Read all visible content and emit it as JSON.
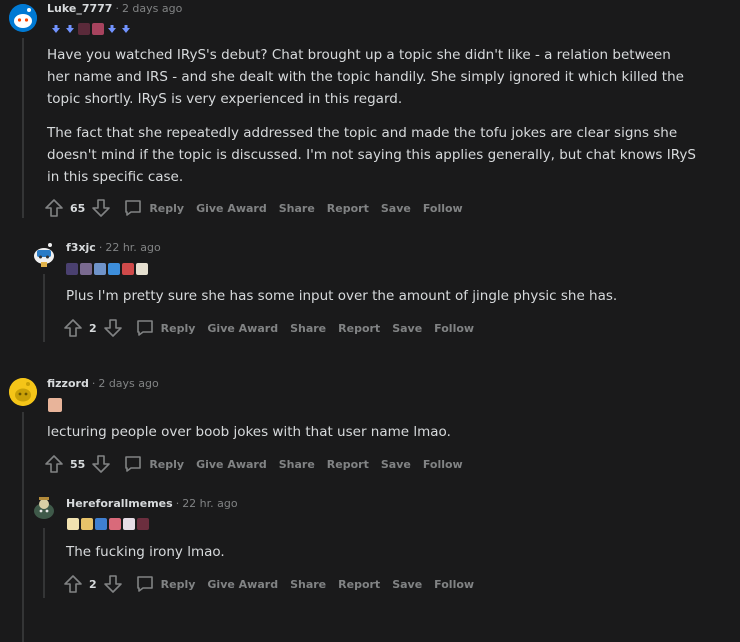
{
  "comments": [
    {
      "username": "Luke_7777",
      "time": "2 days ago",
      "paragraphs": [
        "Have you watched IRyS's debut? Chat brought up a topic she didn't like - a relation between her name and IRS - and she dealt with the topic handily. She simply ignored it which killed the topic shortly. IRyS is very experienced in this regard.",
        "The fact that she repeatedly addressed the topic and made the tofu jokes are clear signs she doesn't mind if the topic is discussed. I'm not saying this applies generally, but chat knows IRyS in this specific case."
      ],
      "score": "65",
      "actions": {
        "reply": "Reply",
        "award": "Give Award",
        "share": "Share",
        "report": "Report",
        "save": "Save",
        "follow": "Follow"
      }
    },
    {
      "username": "f3xjc",
      "time": "22 hr. ago",
      "paragraphs": [
        "Plus I'm pretty sure she has some input over the amount of jingle physic she has."
      ],
      "score": "2",
      "actions": {
        "reply": "Reply",
        "award": "Give Award",
        "share": "Share",
        "report": "Report",
        "save": "Save",
        "follow": "Follow"
      }
    },
    {
      "username": "fizzord",
      "time": "2 days ago",
      "paragraphs": [
        "lecturing people over boob jokes with that user name lmao."
      ],
      "score": "55",
      "actions": {
        "reply": "Reply",
        "award": "Give Award",
        "share": "Share",
        "report": "Report",
        "save": "Save",
        "follow": "Follow"
      }
    },
    {
      "username": "Hereforallmemes",
      "time": "22 hr. ago",
      "paragraphs": [
        "The fucking irony lmao."
      ],
      "score": "2",
      "actions": {
        "reply": "Reply",
        "award": "Give Award",
        "share": "Share",
        "report": "Report",
        "save": "Save",
        "follow": "Follow"
      }
    }
  ],
  "colors": {
    "background": "#1a1a1b",
    "text": "#d7dadc",
    "muted": "#818384",
    "thread_line": "#343536"
  }
}
